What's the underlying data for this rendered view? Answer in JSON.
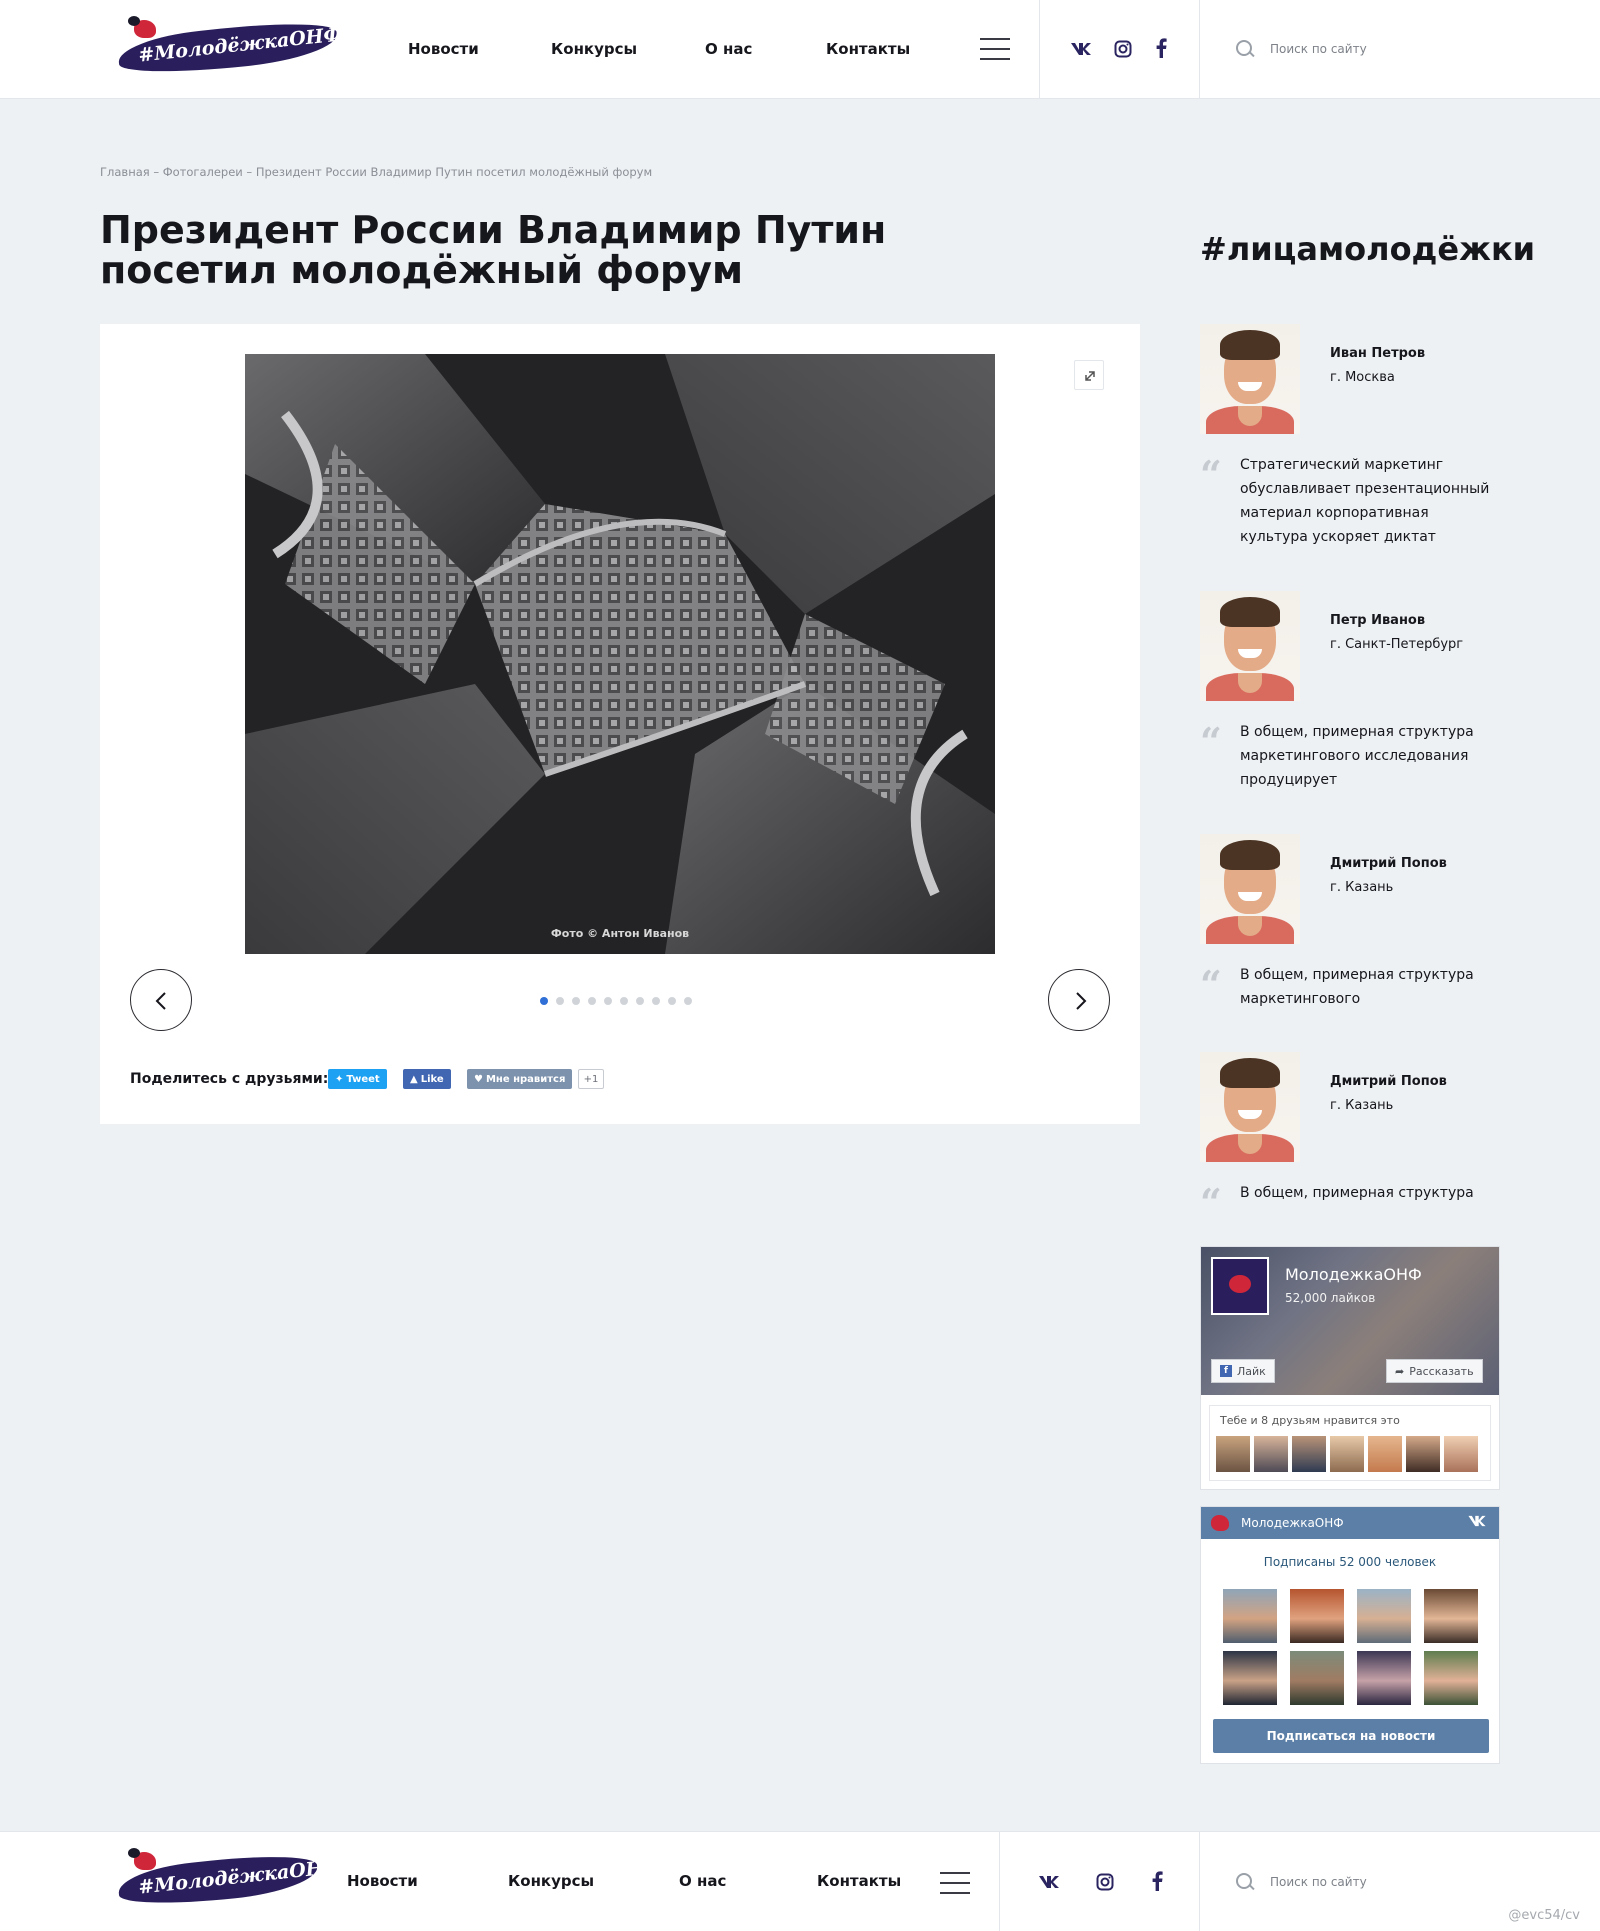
{
  "header": {
    "logo_text": "#МолодёжкаОНФ",
    "nav": [
      "Новости",
      "Конкурсы",
      "О нас",
      "Контакты"
    ],
    "social_icons": [
      "vk-icon",
      "instagram-icon",
      "facebook-icon"
    ],
    "search_placeholder": "Поиск по сайту"
  },
  "breadcrumb": "Главная – Фотогалереи – Президент России Владимир Путин посетил молодёжный форум",
  "page_title": "Президент России Владимир Путин посетил молодёжный форум",
  "gallery": {
    "photo_caption": "Фото © Антон Иванов",
    "slide_count": 10,
    "active_slide": 1,
    "share_label": "Поделитесь с друзьями:",
    "share_buttons": {
      "tweet": "Tweet",
      "like": "Like",
      "vk": "Мне нравится",
      "plus": "+1"
    }
  },
  "sidebar": {
    "title": "#лицамолодёжки",
    "people": [
      {
        "name": "Иван Петров",
        "city": "г. Москва",
        "quote": "Стратегический маркетинг обуславливает презентационный материал корпоративная культура ускоряет диктат"
      },
      {
        "name": "Петр Иванов",
        "city": "г. Санкт-Петербург",
        "quote": "В общем, примерная структура маркетингового исследования продуцирует"
      },
      {
        "name": "Дмитрий Попов",
        "city": "г. Казань",
        "quote": "В общем, примерная структура маркетингового"
      },
      {
        "name": "Дмитрий Попов",
        "city": "г. Казань",
        "quote": "В общем, примерная структура"
      }
    ]
  },
  "fb_widget": {
    "page_name": "МолодежкаОНФ",
    "likes": "52,000 лайков",
    "like_button": "Лайк",
    "share_button": "Рассказать",
    "friends_text": "Тебе и 8 друзьям нравится это"
  },
  "vk_widget": {
    "title": "МолодежкаОНФ",
    "subscribers": "Подписаны 52 000 человек",
    "subscribe_button": "Подписаться на новости"
  },
  "footer": {
    "nav": [
      "Новости",
      "Конкурсы",
      "О нас",
      "Контакты"
    ],
    "search_placeholder": "Поиск по сайту"
  },
  "watermark": "@evc54/cv",
  "colors": {
    "brand_dark": "#2a1f5c",
    "accent_blue": "#2f6fd6",
    "vk_blue": "#5b7fa6",
    "background": "#eef1f4"
  }
}
